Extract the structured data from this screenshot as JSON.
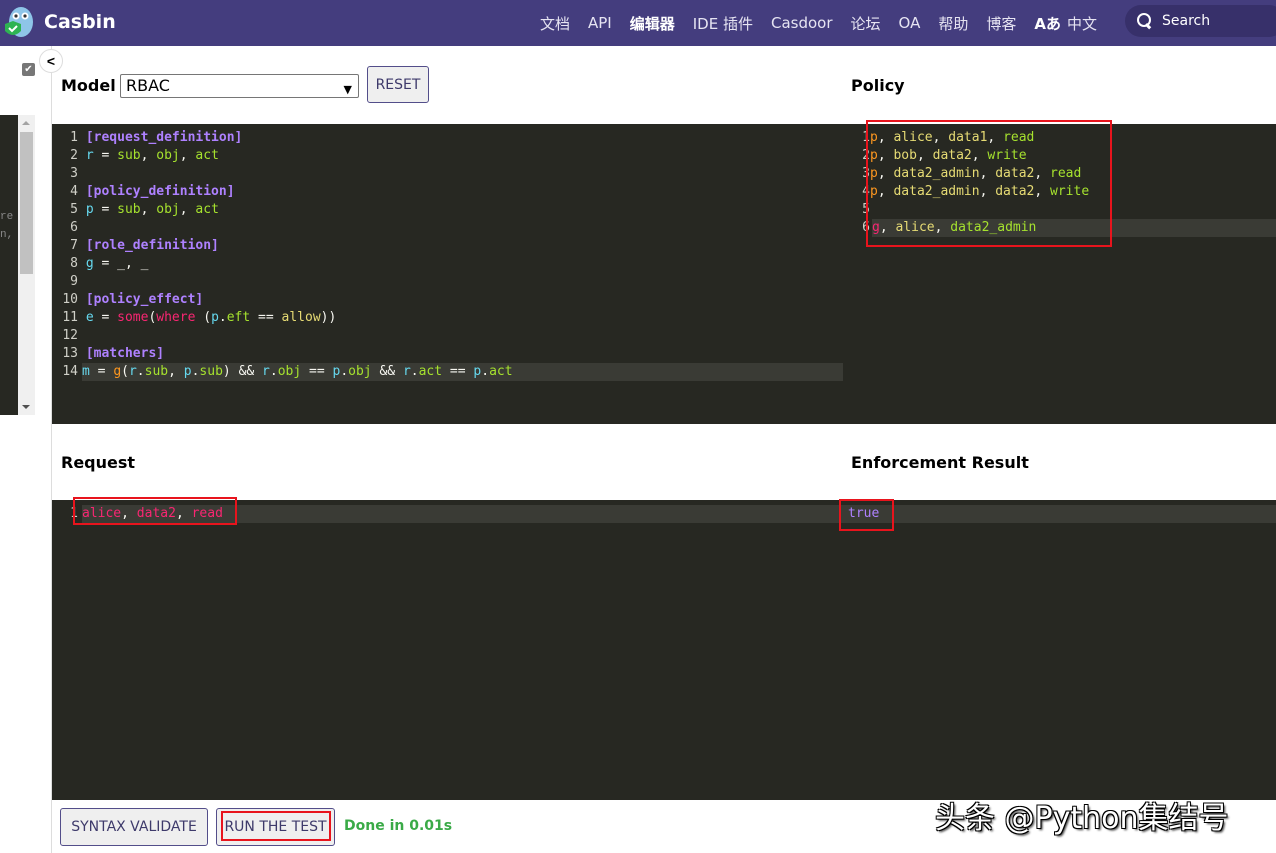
{
  "navbar": {
    "brand": "Casbin",
    "links": [
      "文档",
      "API",
      "编辑器",
      "IDE 插件",
      "Casdoor",
      "论坛",
      "OA",
      "帮助",
      "博客"
    ],
    "active_link": "编辑器",
    "language_icon": "translate-icon",
    "language_label": "中文",
    "search_label": "Search"
  },
  "sidebar": {
    "checkbox_checked": true,
    "partial_text": [
      "re",
      "n,"
    ]
  },
  "model": {
    "label": "Model",
    "selected": "RBAC",
    "reset_label": "RESET",
    "lines": [
      "[request_definition]",
      "r = sub, obj, act",
      "",
      "[policy_definition]",
      "p = sub, obj, act",
      "",
      "[role_definition]",
      "g = _, _",
      "",
      "[policy_effect]",
      "e = some(where (p.eft == allow))",
      "",
      "[matchers]",
      "m = g(r.sub, p.sub) && r.obj == p.obj && r.act == p.act"
    ]
  },
  "policy": {
    "label": "Policy",
    "lines": [
      "p, alice, data1, read",
      "p, bob, data2, write",
      "p, data2_admin, data2, read",
      "p, data2_admin, data2, write",
      "",
      "g, alice, data2_admin"
    ]
  },
  "request": {
    "label": "Request",
    "lines": [
      "alice, data2, read"
    ]
  },
  "result": {
    "label": "Enforcement Result",
    "lines": [
      "true"
    ]
  },
  "footer": {
    "syntax_validate_label": "SYNTAX VALIDATE",
    "run_test_label": "RUN THE TEST",
    "status": "Done in 0.01s"
  },
  "watermark": "头条 @Python集结号",
  "colors": {
    "navbar": "#443d7e",
    "editor_bg": "#272822",
    "status_green": "#3aaa47",
    "highlight_red": "#e8141d"
  }
}
